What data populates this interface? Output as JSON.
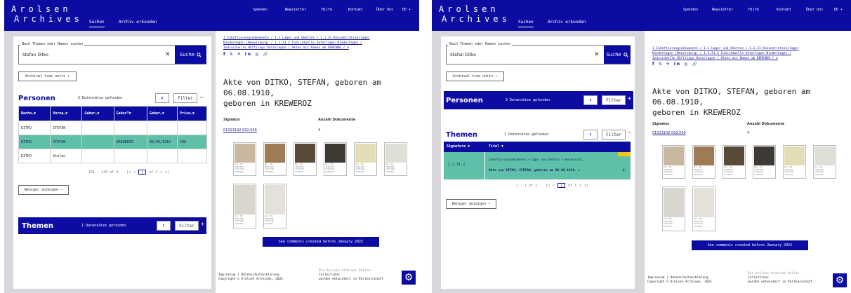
{
  "brand": {
    "line1": "Arolsen",
    "line2": "Archives"
  },
  "nav": {
    "tab_search": "Suchen",
    "tab_archive": "Archiv erkunden"
  },
  "topnav": [
    "Spenden",
    "Newsletter",
    "Hilfe",
    "Kontakt",
    "Über Uns",
    "DE ▾"
  ],
  "search": {
    "legend": "Nach Themen oder Namen suchen",
    "value": "Stefan Ditko",
    "button": "Suche",
    "clear": "✕"
  },
  "archival_tree_btn": "Archival tree units ▾",
  "persons": {
    "title": "Personen",
    "count": "3 Datensätze gefunden",
    "filter": "Filter",
    "columns": [
      "Nachn…▼",
      "Vorna…▼",
      "Gebur…▼",
      "GeburT▼",
      "Gebur…▼",
      "Priso…▼"
    ],
    "rows": [
      [
        "DITKO",
        "STEFAN",
        "",
        "",
        "",
        ""
      ],
      [
        "DITKO",
        "STEFAN",
        "",
        "KREWEROZ",
        "08/06/1910",
        "200"
      ],
      [
        "DITKO",
        "Stefan",
        "",
        "",
        "",
        ""
      ]
    ],
    "pager_range": "101 - 125 of 3",
    "pager_page": "1",
    "pager_of": "of 1"
  },
  "show_less": "Weniger anzeigen —",
  "themes": {
    "title": "Themen",
    "count": "1 Datensätze gefunden",
    "filter": "Filter",
    "col_signature": "Signature ▼",
    "col_title": "Titel ▼",
    "row_signature": "1.1.31.2",
    "row_path": "Inhaftierungsdokumente > Lager und Ghettos > Konzentrat…",
    "row_title": "Akte von DITKO, STEFAN, geboren am 06.08.1910, …",
    "pager_range": "1 - 1 of 1",
    "pager_page": "1",
    "pager_of": "of 1"
  },
  "breadcrumb": {
    "line1": "1 Inhaftierungsdokumente / 1.1 Lager und Ghettos / 1.1.31 Konzentrationslager",
    "line2": "Niederhagen (Wewelsburg) / 1.1.31.2 Individuelle Unterlagen Niederhagen /",
    "line3": "Individuelle Häftlings Unterlagen / Akten mit Namen ab DEMENKO / ⊟"
  },
  "social": "f 𝕏 ✈ in ◎ 🔗",
  "document": {
    "title_line1": "Akte von DITKO, STEFAN, geboren am 06.08.1910,",
    "title_line2": "geboren in KREWEROZ",
    "signature_label": "Signatur",
    "signature_value": "01013102 002.039",
    "count_label": "Anzahl Dokumente",
    "count_value": "4"
  },
  "thumb_caption": "Doc ID:\n3666366\n1379748\n1578451",
  "comments_btn": "See comments created before January 2022",
  "footer": {
    "left1": "Impressum  |  Datenschutzerklärung",
    "left2": "Copyright © Arolsen Archives, 2021",
    "right1": "Die Arolsen Archives Online",
    "right2": "Collections",
    "right3": "wurden entwickelt in Partnerschaft"
  },
  "colors": {
    "brand_blue": "#0c0ca3",
    "selected_row": "#5fc0aa",
    "background": "#d7d7dc"
  }
}
